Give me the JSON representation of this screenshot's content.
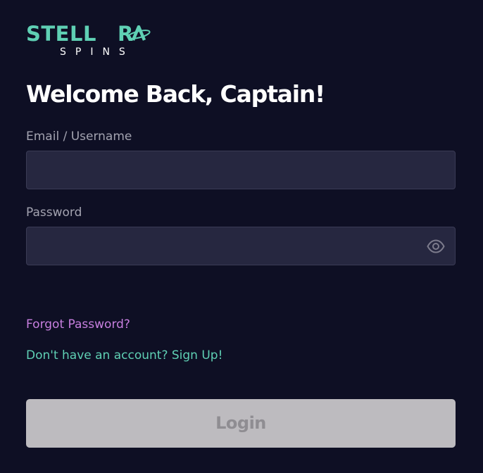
{
  "logo": {
    "title_left": "STELL",
    "title_right": "R",
    "subtitle": "SPINS",
    "accent_color": "#5fd0b4"
  },
  "heading": "Welcome Back, Captain!",
  "form": {
    "email": {
      "label": "Email / Username",
      "value": "",
      "placeholder": ""
    },
    "password": {
      "label": "Password",
      "value": "",
      "placeholder": "",
      "toggle_icon": "eye-icon"
    }
  },
  "links": {
    "forgot_password": "Forgot Password?",
    "sign_up": "Don't have an account? Sign Up!"
  },
  "login_button": {
    "label": "Login",
    "disabled": true
  },
  "colors": {
    "background": "#0e0f24",
    "input_background": "#262740",
    "forgot_link": "#c77fdf",
    "signup_link": "#5fd0b4",
    "button_background": "#bdbbbf",
    "button_text": "#8f8d92"
  }
}
